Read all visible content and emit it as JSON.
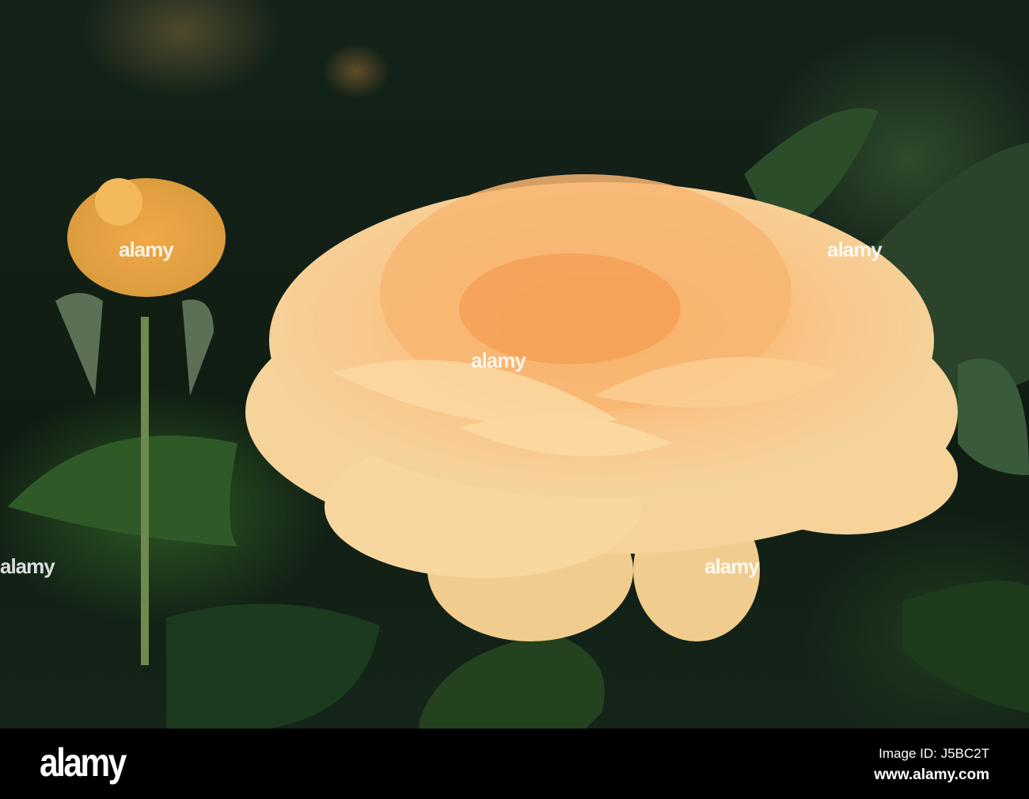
{
  "watermark": {
    "text": "alamy"
  },
  "footer": {
    "logo": "alamy",
    "image_id": "Image ID: J5BC2T",
    "website": "www.alamy.com"
  }
}
